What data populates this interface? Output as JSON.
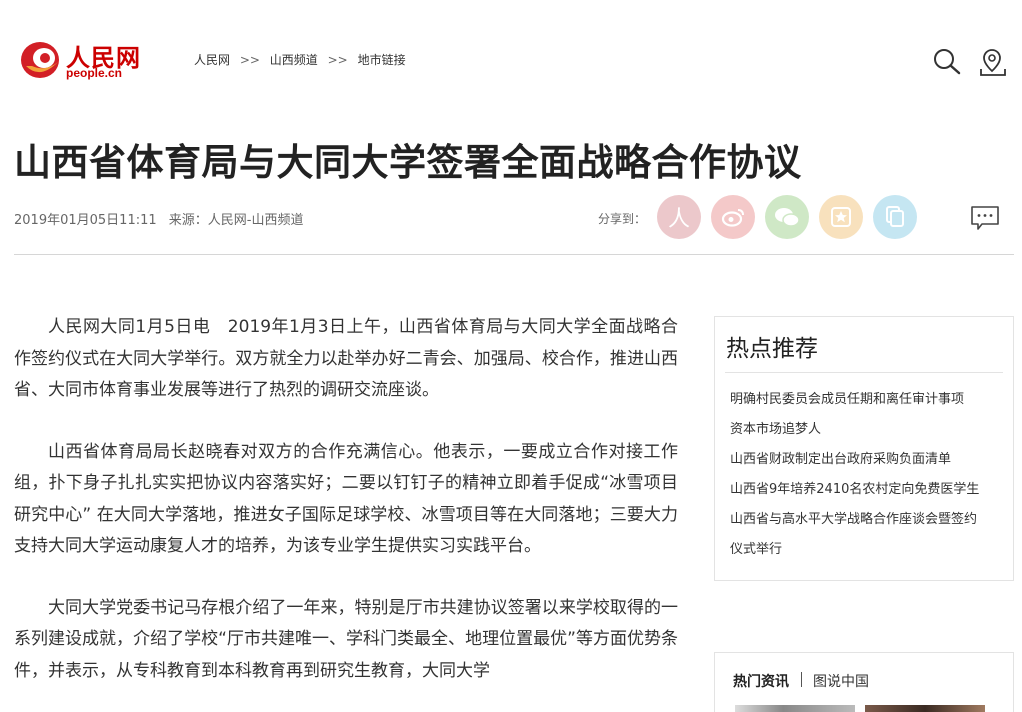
{
  "header": {
    "logo_text": "人民网",
    "logo_sub": "people.cn",
    "breadcrumb": [
      "人民网",
      "山西频道",
      "地市链接"
    ],
    "breadcrumb_sep": ">>"
  },
  "article": {
    "title": "山西省体育局与大同大学签署全面战略合作协议",
    "date": "2019年01月05日11:11",
    "source": "来源：人民网-山西频道",
    "share_label": "分享到：",
    "paragraphs": [
      "人民网大同1月5日电　2019年1月3日上午，山西省体育局与大同大学全面战略合作签约仪式在大同大学举行。双方就全力以赴举办好二青会、加强局、校合作，推进山西省、大同市体育事业发展等进行了热烈的调研交流座谈。",
      "山西省体育局局长赵晓春对双方的合作充满信心。他表示，一要成立合作对接工作组，扑下身子扎扎实实把协议内容落实好；二要以钉钉子的精神立即着手促成“冰雪项目研究中心” 在大同大学落地，推进女子国际足球学校、冰雪项目等在大同落地；三要大力支持大同大学运动康复人才的培养，为该专业学生提供实习实践平台。",
      "大同大学党委书记马存根介绍了一年来，特别是厅市共建协议签署以来学校取得的一系列建设成就，介绍了学校“厅市共建唯一、学科门类最全、地理位置最优”等方面优势条件，并表示，从专科教育到本科教育再到研究生教育，大同大学"
    ]
  },
  "share_buttons": [
    {
      "name": "people-share",
      "glyph": "人",
      "bg": "#ecc8cb",
      "color": "#ffffff"
    },
    {
      "name": "weibo-share",
      "glyph": "微",
      "bg": "#f4c9c9",
      "color": "#ffffff"
    },
    {
      "name": "wechat-share",
      "glyph": "信",
      "bg": "#cfe8c6",
      "color": "#ffffff"
    },
    {
      "name": "favorite-share",
      "glyph": "☆",
      "bg": "#f8e1bd",
      "color": "#ffffff"
    },
    {
      "name": "copy-share",
      "glyph": "❐",
      "bg": "#c5e6f2",
      "color": "#ffffff"
    }
  ],
  "sidebar": {
    "hot_title": "热点推荐",
    "hot_items": [
      "明确村民委员会成员任期和离任审计事项",
      "资本市场追梦人",
      "山西省财政制定出台政府采购负面清单",
      "山西省9年培养2410名农村定向免费医学生",
      "山西省与高水平大学战略合作座谈会暨签约",
      "仪式举行"
    ],
    "tabs": [
      "热门资讯",
      "图说中国"
    ]
  },
  "colors": {
    "brand_red": "#cc0000",
    "divider": "#d6d6d6",
    "text": "#333333"
  }
}
